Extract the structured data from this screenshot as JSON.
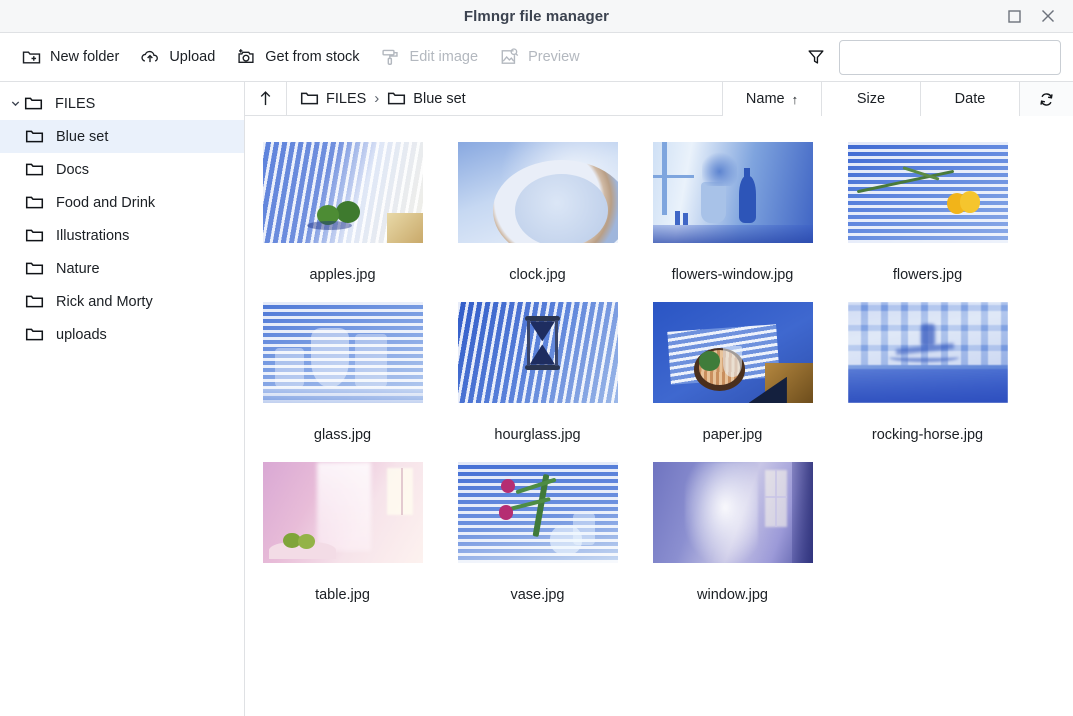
{
  "window": {
    "title": "Flmngr file manager",
    "controls": [
      {
        "name": "maximize-button",
        "icon": "square-icon"
      },
      {
        "name": "close-button",
        "icon": "close-icon"
      }
    ]
  },
  "toolbar": {
    "buttons": [
      {
        "label": "New folder",
        "icon": "folder-plus-icon",
        "disabled": false
      },
      {
        "label": "Upload",
        "icon": "cloud-upload-icon",
        "disabled": false
      },
      {
        "label": "Get from stock",
        "icon": "camera-plus-icon",
        "disabled": false
      },
      {
        "label": "Edit image",
        "icon": "paint-roller-icon",
        "disabled": true
      },
      {
        "label": "Preview",
        "icon": "image-search-icon",
        "disabled": true
      }
    ],
    "filter_icon": "filter-funnel-icon",
    "filter_value": "",
    "filter_placeholder": ""
  },
  "sidebar": {
    "root": {
      "label": "FILES",
      "icon": "folder-icon",
      "caret": "chevron-down-icon",
      "expanded": true
    },
    "items": [
      {
        "label": "Blue set",
        "icon": "folder-icon",
        "selected": true
      },
      {
        "label": "Docs",
        "icon": "folder-icon",
        "selected": false
      },
      {
        "label": "Food and Drink",
        "icon": "folder-icon",
        "selected": false
      },
      {
        "label": "Illustrations",
        "icon": "folder-icon",
        "selected": false
      },
      {
        "label": "Nature",
        "icon": "folder-icon",
        "selected": false
      },
      {
        "label": "Rick and Morty",
        "icon": "folder-icon",
        "selected": false
      },
      {
        "label": "uploads",
        "icon": "folder-icon",
        "selected": false
      }
    ]
  },
  "pathbar": {
    "up_icon": "arrow-up-icon",
    "breadcrumb": [
      {
        "label": "FILES",
        "icon": "folder-icon"
      },
      {
        "label": "Blue set",
        "icon": "folder-icon"
      }
    ],
    "separator": "›"
  },
  "sort": {
    "tabs": [
      {
        "label": "Name",
        "active": true,
        "direction": "↑"
      },
      {
        "label": "Size",
        "active": false,
        "direction": ""
      },
      {
        "label": "Date",
        "active": false,
        "direction": ""
      }
    ],
    "refresh_icon": "refresh-icon"
  },
  "files": [
    {
      "name": "apples.jpg",
      "style": "apples"
    },
    {
      "name": "clock.jpg",
      "style": "clock"
    },
    {
      "name": "flowers-window.jpg",
      "style": "flowers-window"
    },
    {
      "name": "flowers.jpg",
      "style": "flowers"
    },
    {
      "name": "glass.jpg",
      "style": "glass"
    },
    {
      "name": "hourglass.jpg",
      "style": "hourglass"
    },
    {
      "name": "paper.jpg",
      "style": "paper"
    },
    {
      "name": "rocking-horse.jpg",
      "style": "rocking-horse"
    },
    {
      "name": "table.jpg",
      "style": "table"
    },
    {
      "name": "vase.jpg",
      "style": "vase"
    },
    {
      "name": "window.jpg",
      "style": "window"
    }
  ],
  "colors": {
    "accent_blue": "#2f5fd0",
    "selection_bg": "#eaf1fb",
    "border": "#dfe1e4",
    "titlebar_bg": "#f6f7f8",
    "text": "#1b1f24",
    "text_disabled": "#b3b8bf"
  }
}
